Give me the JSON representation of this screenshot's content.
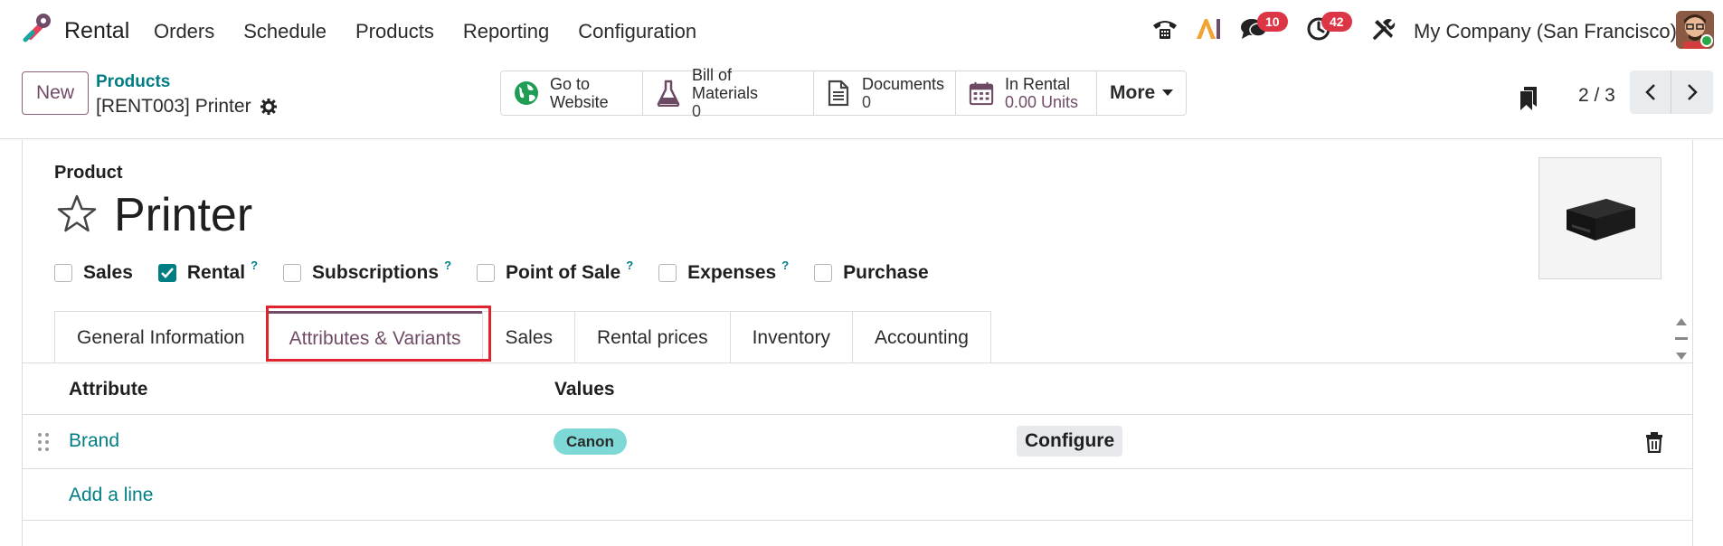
{
  "navbar": {
    "app_name": "Rental",
    "menu": [
      "Orders",
      "Schedule",
      "Products",
      "Reporting",
      "Configuration"
    ],
    "messages_count": "10",
    "activities_count": "42",
    "company": "My Company (San Francisco)"
  },
  "control": {
    "new_label": "New",
    "breadcrumb": "Products",
    "record_name": "[RENT003] Printer",
    "smart_buttons": {
      "website": {
        "line1": "Go to",
        "line2": "Website"
      },
      "bom": {
        "label": "Bill of Materials",
        "value": "0"
      },
      "documents": {
        "label": "Documents",
        "value": "0"
      },
      "rental": {
        "label": "In Rental",
        "value": "0.00 Units"
      },
      "more": "More"
    },
    "pager": "2 / 3"
  },
  "form": {
    "field_label": "Product",
    "product_name": "Printer",
    "flags": [
      {
        "label": "Sales",
        "checked": false,
        "help": ""
      },
      {
        "label": "Rental",
        "checked": true,
        "help": "?"
      },
      {
        "label": "Subscriptions",
        "checked": false,
        "help": "?"
      },
      {
        "label": "Point of Sale",
        "checked": false,
        "help": "?"
      },
      {
        "label": "Expenses",
        "checked": false,
        "help": "?"
      },
      {
        "label": "Purchase",
        "checked": false,
        "help": ""
      }
    ],
    "tabs": [
      "General Information",
      "Attributes & Variants",
      "Sales",
      "Rental prices",
      "Inventory",
      "Accounting"
    ],
    "active_tab": "Attributes & Variants"
  },
  "table": {
    "headers": {
      "attribute": "Attribute",
      "values": "Values"
    },
    "rows": [
      {
        "attribute": "Brand",
        "value": "Canon",
        "action": "Configure"
      }
    ],
    "add_line": "Add a line"
  },
  "colors": {
    "accent": "#714b67",
    "link": "#017e84",
    "tag": "#7ed9d6",
    "badge": "#dc3545",
    "highlight": "#e0242e"
  }
}
